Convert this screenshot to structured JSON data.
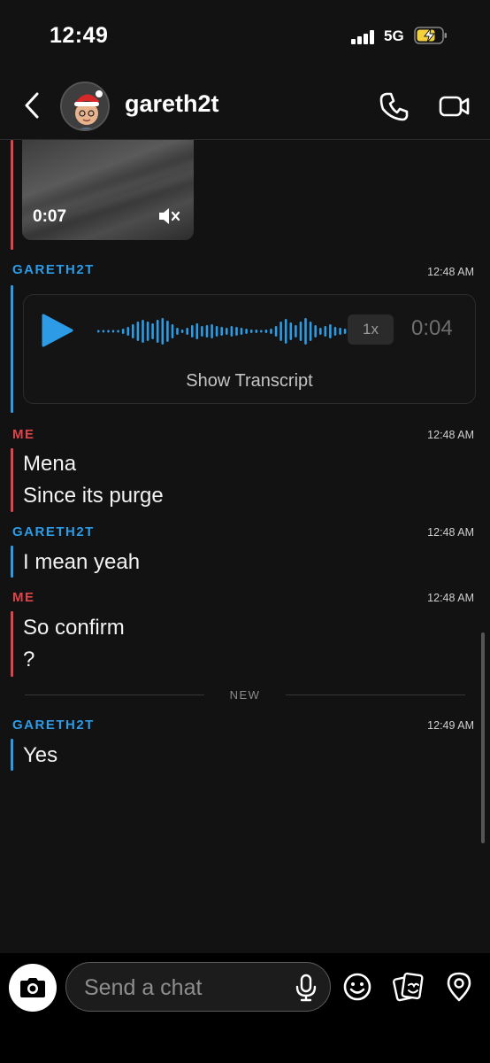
{
  "status_bar": {
    "time": "12:49",
    "network": "5G"
  },
  "header": {
    "contact_name": "gareth2t"
  },
  "messages": {
    "video": {
      "duration": "0:07"
    },
    "m1": {
      "sender": "GARETH2T",
      "timestamp": "12:48 AM",
      "voice_duration": "0:04",
      "speed": "1x",
      "transcript_label": "Show Transcript"
    },
    "m2": {
      "sender": "ME",
      "timestamp": "12:48 AM",
      "line1": "Mena",
      "line2": "Since its purge"
    },
    "m3": {
      "sender": "GARETH2T",
      "timestamp": "12:48 AM",
      "line1": "I mean yeah"
    },
    "m4": {
      "sender": "ME",
      "timestamp": "12:48 AM",
      "line1": "So confirm",
      "line2": "?"
    },
    "divider": "NEW",
    "m5": {
      "sender": "GARETH2T",
      "timestamp": "12:49 AM",
      "line1": "Yes"
    }
  },
  "input": {
    "placeholder": "Send a chat"
  },
  "colors": {
    "me": "#e0434a",
    "friend": "#2d9be5",
    "background": "#121212"
  }
}
